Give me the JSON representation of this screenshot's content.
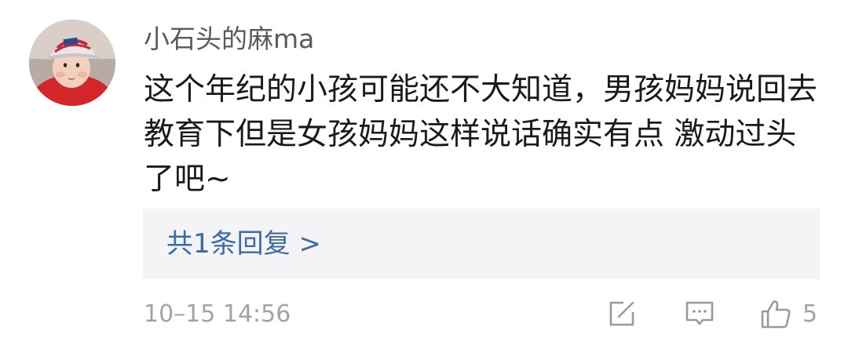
{
  "comment": {
    "username": "小石头的麻ma",
    "content": "这个年纪的小孩可能还不大知道，男孩妈妈说回去\n教育下但是女孩妈妈这样说话确实有点 激动过头\n了吧~",
    "reply_link": "共1条回复 >",
    "timestamp": "10–15 14:56",
    "like_count": "5"
  },
  "icons": {
    "share": "share-icon",
    "comment": "comment-icon",
    "like": "thumbs-up-icon"
  },
  "colors": {
    "link": "#3d6aa8",
    "meta": "#a3a3a3",
    "reply_bg": "#f4f4f6"
  }
}
